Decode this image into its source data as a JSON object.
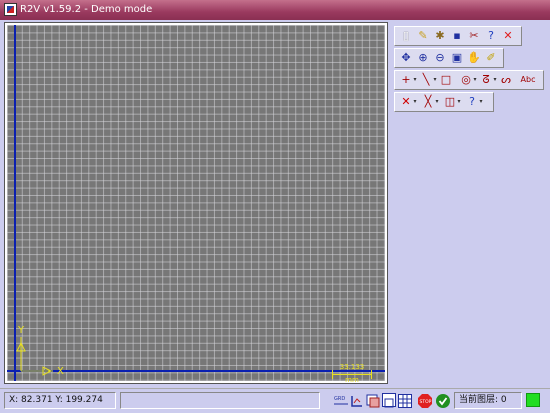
{
  "window": {
    "title": "R2V v1.59.2 - Demo mode"
  },
  "canvas": {
    "ucs": {
      "x_label": "X",
      "y_label": "Y"
    },
    "scale": {
      "value": "33.133",
      "unit": "mm"
    }
  },
  "toolbar": {
    "row1": [
      {
        "name": "new-file-icon",
        "glyph": "▯",
        "color": "#ffffff"
      },
      {
        "name": "open-file-icon",
        "glyph": "✎",
        "color": "#c8a020"
      },
      {
        "name": "settings-icon",
        "glyph": "✱",
        "color": "#8a6a20"
      },
      {
        "name": "save-icon",
        "glyph": "▪",
        "color": "#2030a0"
      },
      {
        "name": "tools-icon",
        "glyph": "✂",
        "color": "#a02020"
      },
      {
        "name": "help-icon",
        "glyph": "?",
        "color": "#2040c0"
      },
      {
        "name": "close-icon",
        "glyph": "✕",
        "color": "#e02020"
      }
    ],
    "row2": [
      {
        "name": "pan-icon",
        "glyph": "✥",
        "color": "#2030a0"
      },
      {
        "name": "zoom-in-icon",
        "glyph": "⊕",
        "color": "#2030a0"
      },
      {
        "name": "zoom-out-icon",
        "glyph": "⊖",
        "color": "#2030a0"
      },
      {
        "name": "zoom-window-icon",
        "glyph": "▣",
        "color": "#2030a0"
      },
      {
        "name": "hand-icon",
        "glyph": "✋",
        "color": "#c09060"
      },
      {
        "name": "brush-icon",
        "glyph": "✐",
        "color": "#c0a000"
      }
    ],
    "row3": [
      {
        "name": "point-tool-icon",
        "glyph": "+",
        "color": "#a00000"
      },
      {
        "name": "line-tool-icon",
        "glyph": "╲",
        "color": "#a00000"
      },
      {
        "name": "rect-tool-icon",
        "glyph": "□",
        "color": "#a00000"
      },
      {
        "name": "circle-tool-icon",
        "glyph": "◎",
        "color": "#a00000"
      },
      {
        "name": "polyline-tool-icon",
        "glyph": "ᘔ",
        "color": "#a00000"
      },
      {
        "name": "curve-tool-icon",
        "glyph": "ᔕ",
        "color": "#a00000"
      },
      {
        "name": "text-tool-icon",
        "glyph": "Abc",
        "color": "#a00000"
      }
    ],
    "row4": [
      {
        "name": "delete-icon",
        "glyph": "✕",
        "color": "#d00000"
      },
      {
        "name": "cut-icon",
        "glyph": "╳",
        "color": "#a00000"
      },
      {
        "name": "edit-node-icon",
        "glyph": "◫",
        "color": "#a00000"
      },
      {
        "name": "query-icon",
        "glyph": "?",
        "color": "#2040c0"
      }
    ]
  },
  "statusbar": {
    "coords": "X: 82.371 Y: 199.274",
    "layer": "当前图层: 0"
  }
}
